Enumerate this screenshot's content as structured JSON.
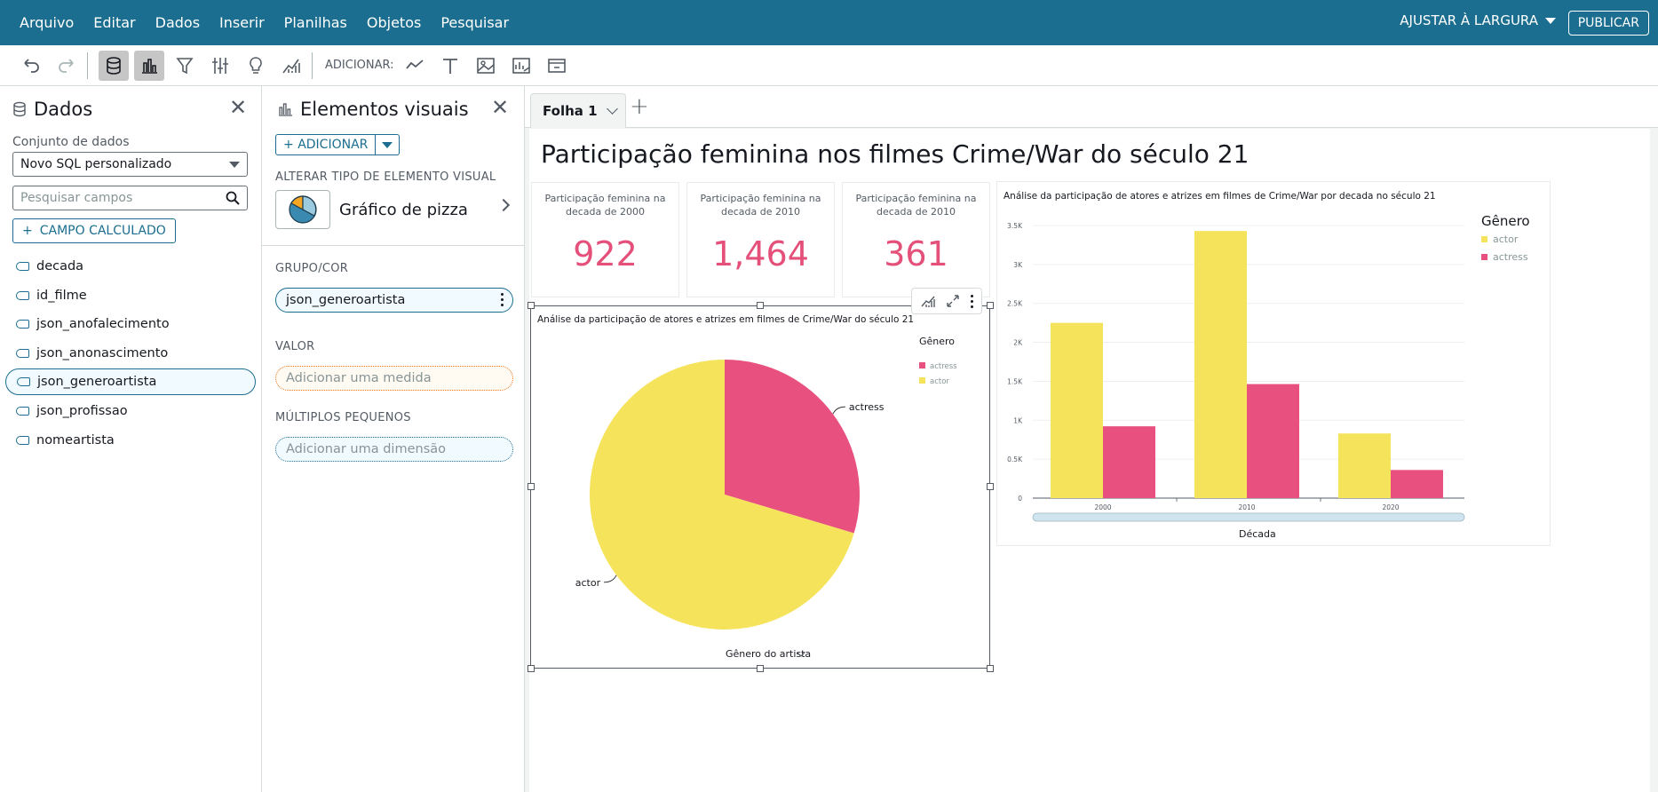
{
  "menubar": {
    "items": [
      "Arquivo",
      "Editar",
      "Dados",
      "Inserir",
      "Planilhas",
      "Objetos",
      "Pesquisar"
    ],
    "fit_width": "AJUSTAR À LARGURA",
    "publish": "PUBLICAR",
    "bg_color": "#1b6e8f"
  },
  "toolbar": {
    "add_label": "ADICIONAR:",
    "icons": [
      "undo-icon",
      "redo-icon",
      "database-icon",
      "bar-chart-icon",
      "filter-icon",
      "sliders-icon",
      "lightbulb-icon",
      "forecast-icon",
      "line-chart-icon",
      "text-icon",
      "image-icon",
      "insight-icon",
      "embed-icon"
    ]
  },
  "data_panel": {
    "title": "Dados",
    "dataset_label": "Conjunto de dados",
    "dataset_value": "Novo SQL personalizado",
    "search_placeholder": "Pesquisar campos",
    "calc_field": "CAMPO CALCULADO",
    "fields": [
      "decada",
      "id_filme",
      "json_anofalecimento",
      "json_anonascimento",
      "json_generoartista",
      "json_profissao",
      "nomeartista"
    ],
    "selected_field": "json_generoartista"
  },
  "visuals_panel": {
    "title": "Elementos visuais",
    "add_button": "ADICIONAR",
    "change_type_label": "ALTERAR TIPO DE ELEMENTO VISUAL",
    "visual_type": "Gráfico de pizza",
    "group_label": "GRUPO/COR",
    "group_value": "json_generoartista",
    "value_label": "VALOR",
    "value_placeholder": "Adicionar uma medida",
    "small_multiples_label": "MÚLTIPLOS PEQUENOS",
    "small_multiples_placeholder": "Adicionar uma dimensão"
  },
  "canvas": {
    "sheet_tab": "Folha 1",
    "sheet_title": "Participação feminina nos filmes Crime/War do século 21",
    "kpis": [
      {
        "label": "Participação feminina na decada de 2000",
        "value": "922"
      },
      {
        "label": "Participação feminina na decada de 2010",
        "value": "1,464"
      },
      {
        "label": "Participação feminina na decada de 2010",
        "value": "361"
      }
    ],
    "kpi_color": "#e4507a"
  },
  "colors": {
    "actor": "#f5e35c",
    "actress": "#e8517f"
  },
  "chart_data": [
    {
      "type": "pie",
      "title": "Análise da participação de atores e atrizes em filmes de Crime/War do século 21",
      "legend_title": "Gênero",
      "legend_position": "top-right",
      "categories": [
        "actress",
        "actor"
      ],
      "values": [
        2747,
        6527
      ],
      "slice_labels": [
        "actress",
        "actor"
      ],
      "xlabel": "Gênero do artista"
    },
    {
      "type": "bar",
      "title": "Análise da participação de atores e atrizes em filmes de Crime/War por decada no século 21",
      "legend_title": "Gênero",
      "legend_position": "top-right",
      "categories": [
        "2000",
        "2010",
        "2020"
      ],
      "series": [
        {
          "name": "actor",
          "values": [
            2250,
            3430,
            830
          ]
        },
        {
          "name": "actress",
          "values": [
            922,
            1464,
            361
          ]
        }
      ],
      "xlabel": "Década",
      "ylabel": "",
      "ylim": [
        0,
        3500
      ],
      "yticks": [
        0,
        500,
        1000,
        1500,
        2000,
        2500,
        3000,
        3500
      ],
      "ytick_labels": [
        "0",
        "0.5K",
        "1K",
        "1.5K",
        "2K",
        "2.5K",
        "3K",
        "3.5K"
      ],
      "grid": true
    }
  ]
}
